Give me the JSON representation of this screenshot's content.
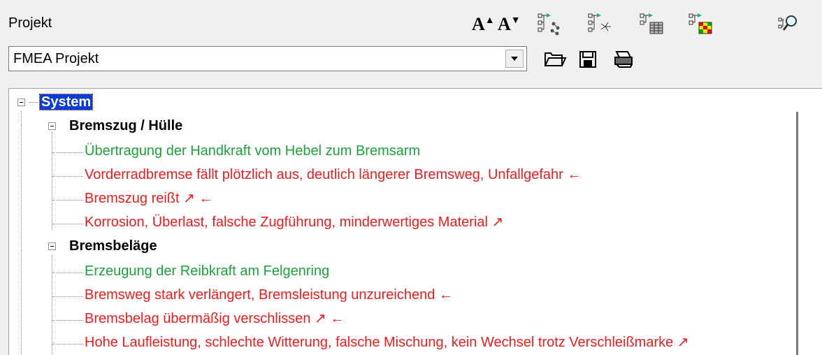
{
  "header": {
    "project_label": "Projekt"
  },
  "combo": {
    "value": "FMEA Projekt"
  },
  "toolbar": {
    "font_increase": "A",
    "font_decrease": "A"
  },
  "tree": {
    "root": "System",
    "groups": [
      {
        "label": "Bremszug / Hülle",
        "items": [
          {
            "text": "Übertragung der Handkraft vom Hebel zum Bremsarm",
            "color": "#1aa33a"
          },
          {
            "text": "Vorderradbremse fällt plötzlich aus, deutlich längerer Bremsweg, Unfallgefahr ←",
            "color": "#ee1c1c"
          },
          {
            "text": "Bremszug reißt ↗ ←",
            "color": "#ee1c1c"
          },
          {
            "text": "Korrosion, Überlast, falsche Zugführung, minderwertiges Material ↗",
            "color": "#ee1c1c"
          }
        ]
      },
      {
        "label": "Bremsbeläge",
        "items": [
          {
            "text": "Erzeugung der Reibkraft am Felgenring",
            "color": "#1aa33a"
          },
          {
            "text": "Bremsweg stark verlängert, Bremsleistung unzureichend ←",
            "color": "#ee1c1c"
          },
          {
            "text": "Bremsbelag übermäßig verschlissen ↗ ←",
            "color": "#ee1c1c"
          },
          {
            "text": "Hohe Laufleistung, schlechte Witterung, falsche Mischung, kein Wechsel trotz Verschleißmarke ↗",
            "color": "#ee1c1c"
          }
        ]
      }
    ]
  },
  "icons": [
    "font-increase-icon",
    "font-decrease-icon",
    "tree-view-icon",
    "network-view-icon",
    "table-view-icon",
    "matrix-view-icon",
    "search-zoom-icon",
    "open-folder-icon",
    "save-icon",
    "print-icon"
  ]
}
